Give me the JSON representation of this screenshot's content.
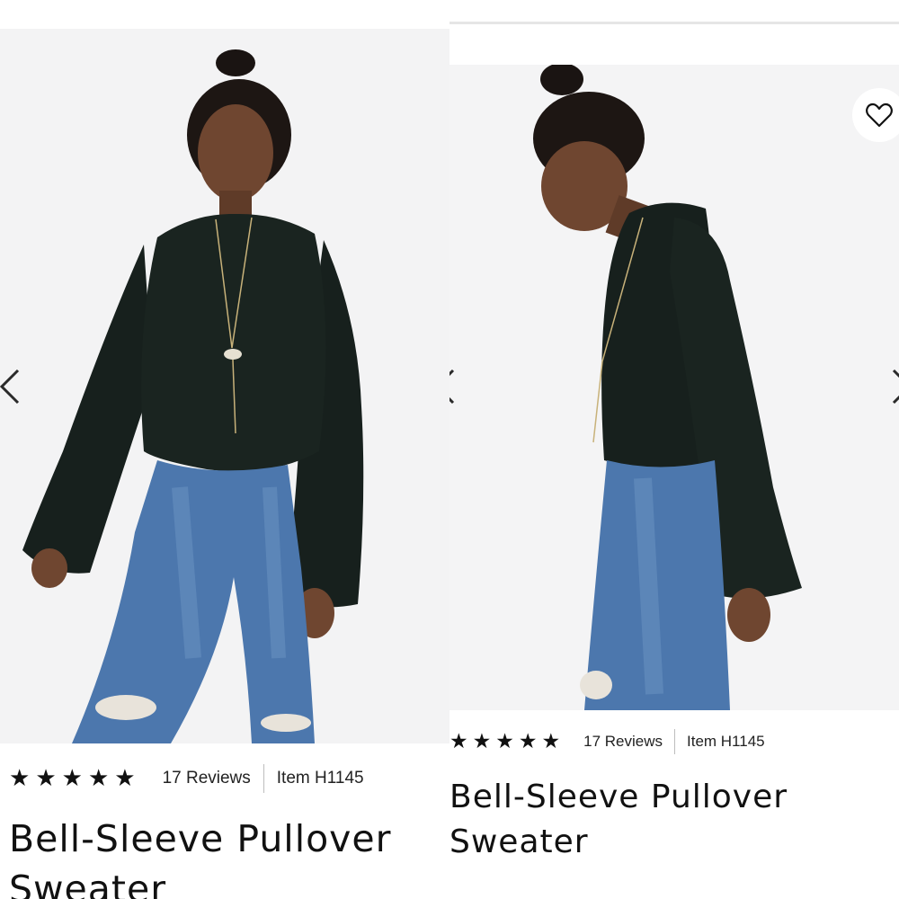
{
  "left": {
    "rating": {
      "stars": 5,
      "reviews": "17 Reviews",
      "item": "Item H1145"
    },
    "title_line1": "Bell-Sleeve Pullover",
    "title_line2": "Sweater"
  },
  "right": {
    "rating": {
      "stars": 5,
      "reviews": "17 Reviews",
      "item": "Item H1145"
    },
    "title_line1": "Bell-Sleeve Pullover",
    "title_line2": "Sweater"
  },
  "icons": {
    "prev": "chevron-left-icon",
    "next": "chevron-right-icon",
    "favorite": "heart-outline-icon",
    "star": "star-filled-icon"
  },
  "colors": {
    "sweater": "#17201d",
    "denim": "#4c77ad",
    "skin": "#6f4630",
    "background": "#f3f3f4",
    "text": "#111111"
  }
}
